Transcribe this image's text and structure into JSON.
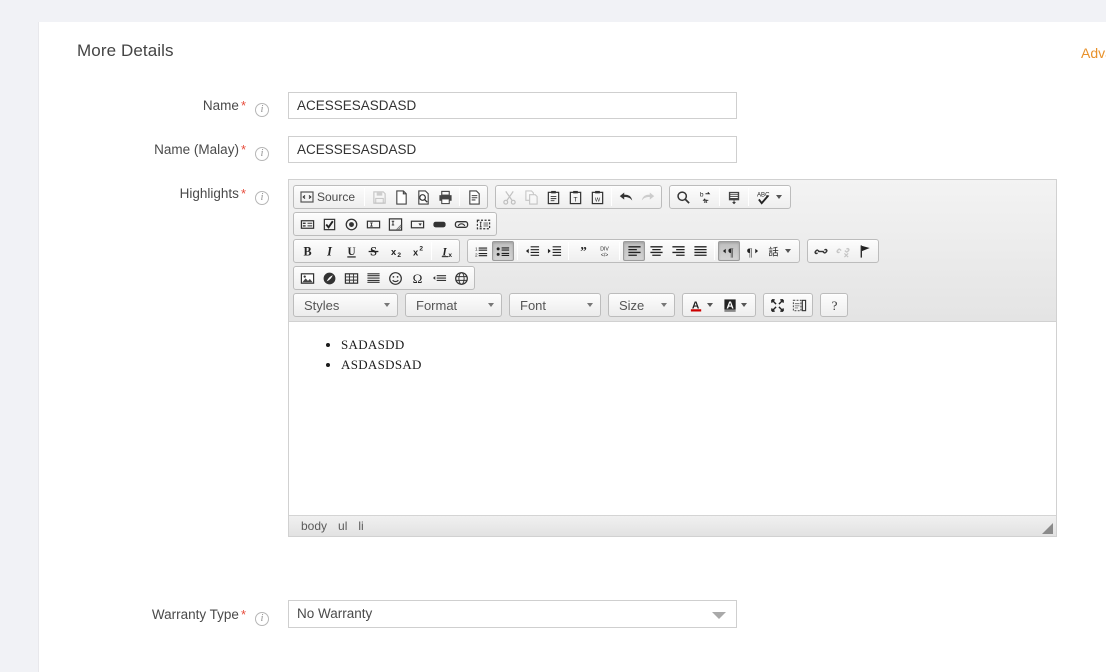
{
  "page": {
    "cut_off_top_text": "",
    "title": "More Details",
    "advanced_link": "Adva"
  },
  "fields": {
    "name": {
      "label": "Name",
      "required_mark": "*",
      "info_glyph": "i",
      "value": "ACESSESASDASD",
      "placeholder": ""
    },
    "name_malay": {
      "label": "Name (Malay)",
      "required_mark": "*",
      "info_glyph": "i",
      "value": "ACESSESASDASD",
      "placeholder": ""
    },
    "highlights": {
      "label": "Highlights",
      "required_mark": "*",
      "info_glyph": "i"
    },
    "warranty_type": {
      "label": "Warranty Type",
      "required_mark": "*",
      "info_glyph": "i",
      "value": "No Warranty"
    }
  },
  "editor": {
    "source_button_label": "Source",
    "toolbar_row1": [
      {
        "name": "source-button",
        "state": "normal"
      },
      {
        "name": "save-icon",
        "state": "disabled"
      },
      {
        "name": "new-page-icon",
        "state": "normal"
      },
      {
        "name": "preview-icon",
        "state": "normal"
      },
      {
        "name": "print-icon",
        "state": "normal"
      },
      {
        "name": "templates-icon",
        "state": "normal"
      },
      {
        "name": "cut-icon",
        "state": "disabled"
      },
      {
        "name": "copy-icon",
        "state": "disabled"
      },
      {
        "name": "paste-icon",
        "state": "normal"
      },
      {
        "name": "paste-as-text-icon",
        "state": "normal"
      },
      {
        "name": "paste-from-word-icon",
        "state": "normal"
      },
      {
        "name": "undo-icon",
        "state": "normal"
      },
      {
        "name": "redo-icon",
        "state": "disabled"
      },
      {
        "name": "find-icon",
        "state": "normal"
      },
      {
        "name": "replace-icon",
        "state": "normal"
      },
      {
        "name": "select-all-icon",
        "state": "normal"
      },
      {
        "name": "spellcheck-icon",
        "state": "normal"
      }
    ],
    "toolbar_row2": [
      {
        "name": "form-icon",
        "state": "normal"
      },
      {
        "name": "checkbox-icon",
        "state": "normal"
      },
      {
        "name": "radio-button-icon",
        "state": "normal"
      },
      {
        "name": "text-field-icon",
        "state": "normal"
      },
      {
        "name": "textarea-icon",
        "state": "normal"
      },
      {
        "name": "select-field-icon",
        "state": "normal"
      },
      {
        "name": "button-icon",
        "state": "normal"
      },
      {
        "name": "image-button-icon",
        "state": "normal"
      },
      {
        "name": "hidden-field-icon",
        "state": "normal"
      }
    ],
    "toolbar_row3": [
      {
        "name": "bold-icon",
        "label": "B",
        "state": "normal"
      },
      {
        "name": "italic-icon",
        "label": "I",
        "state": "normal"
      },
      {
        "name": "underline-icon",
        "label": "U",
        "state": "normal"
      },
      {
        "name": "strikethrough-icon",
        "label": "S",
        "state": "normal"
      },
      {
        "name": "subscript-icon",
        "label": "x₂",
        "state": "normal"
      },
      {
        "name": "superscript-icon",
        "label": "x²",
        "state": "normal"
      },
      {
        "name": "remove-format-icon",
        "label": "Ix",
        "state": "normal"
      },
      {
        "name": "numbered-list-icon",
        "state": "normal"
      },
      {
        "name": "bulleted-list-icon",
        "state": "active"
      },
      {
        "name": "decrease-indent-icon",
        "state": "normal"
      },
      {
        "name": "increase-indent-icon",
        "state": "normal"
      },
      {
        "name": "blockquote-icon",
        "state": "normal"
      },
      {
        "name": "create-div-icon",
        "state": "normal"
      },
      {
        "name": "align-left-icon",
        "state": "active"
      },
      {
        "name": "align-center-icon",
        "state": "normal"
      },
      {
        "name": "align-right-icon",
        "state": "normal"
      },
      {
        "name": "justify-icon",
        "state": "normal"
      },
      {
        "name": "text-direction-ltr-icon",
        "state": "active"
      },
      {
        "name": "text-direction-rtl-icon",
        "state": "normal"
      },
      {
        "name": "language-icon",
        "state": "normal"
      },
      {
        "name": "link-icon",
        "state": "normal"
      },
      {
        "name": "unlink-icon",
        "state": "disabled"
      },
      {
        "name": "anchor-icon",
        "state": "normal"
      }
    ],
    "toolbar_row4": [
      {
        "name": "image-icon",
        "state": "normal"
      },
      {
        "name": "flash-icon",
        "state": "normal"
      },
      {
        "name": "table-icon",
        "state": "normal"
      },
      {
        "name": "horizontal-rule-icon",
        "state": "normal"
      },
      {
        "name": "smiley-icon",
        "state": "normal"
      },
      {
        "name": "special-character-icon",
        "state": "normal"
      },
      {
        "name": "page-break-icon",
        "state": "normal"
      },
      {
        "name": "iframe-icon",
        "state": "normal"
      }
    ],
    "combos": {
      "styles": "Styles",
      "format": "Format",
      "font": "Font",
      "size": "Size"
    },
    "toolbar_row5_buttons": [
      {
        "name": "text-color-icon",
        "state": "normal"
      },
      {
        "name": "background-color-icon",
        "state": "normal"
      },
      {
        "name": "maximize-icon",
        "state": "normal"
      },
      {
        "name": "show-blocks-icon",
        "state": "normal"
      },
      {
        "name": "about-icon",
        "label": "?",
        "state": "normal"
      }
    ],
    "content_list": [
      "SADASDD",
      "ASDASDSAD"
    ],
    "element_path": [
      "body",
      "ul",
      "li"
    ]
  },
  "colors": {
    "page_background": "#f1f2f6",
    "card_background": "#ffffff",
    "accent_link": "#e8912a",
    "required_star": "#e74c3c",
    "toolbar_background": "#e9e9e9",
    "input_border": "#cfcfcf"
  }
}
